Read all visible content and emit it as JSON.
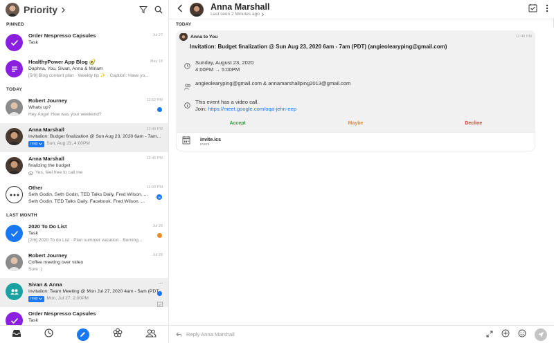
{
  "left": {
    "title": "Priority",
    "sections": {
      "pinned": "PINNED",
      "today": "TODAY",
      "last_month": "LAST MONTH"
    },
    "items": [
      {
        "name": "Order Nespresso Capsules",
        "line2": "Task",
        "line3": "",
        "time": "Jul 27"
      },
      {
        "name": "HealthyPower App Blog 🥑",
        "line2": "Daphna, You, Sivan, Anna & Miriam",
        "line3": "[5/9] Blog content plan · Weekly tip ✨ · Caption: Have yo...",
        "time": "May 18"
      },
      {
        "name": "Robert Journey",
        "line2": "Whats up?",
        "line3": "Hey Ange! How was your weekend?",
        "time": "12:52 PM"
      },
      {
        "name": "Anna Marshall",
        "line2": "Invitation: Budget finalization @ Sun Aug 23, 2020 6am - 7am...",
        "line3": "Sun, Aug 23, 4:00PM",
        "rsvp": "rsvp",
        "time": "12:48 PM"
      },
      {
        "name": "Anna Marshall",
        "line2": "finalizing the budget",
        "line3": "Yes, feel free to call me",
        "time": "12:46 PM"
      },
      {
        "name": "Other",
        "line2": "Seth Godin, Seth Godin, TED Talks Daily, Fred Wilson, ...",
        "line3": "Seth Godin. TED Talks Daily. Facebook. Fred Wilson. ...",
        "time": "12:00 PM",
        "badge": "26"
      },
      {
        "name": "2020 To Do List",
        "line2": "Task",
        "line3": "[2/6] 2020 To do List · Plan summer vacation · Burning...",
        "time": "Jul 28"
      },
      {
        "name": "Robert Journey",
        "line2": "Coffee meeting over video",
        "line3": "Sure :)",
        "time": "Jul 28"
      },
      {
        "name": "Sivan & Anna",
        "line2": "Invitation: Team Meeting @ Mon Jul 27, 2020 4am - 5am (PDT...",
        "line3": "Mon, Jul 27, 2:00PM",
        "rsvp": "rsvp",
        "time": "..."
      },
      {
        "name": "Order Nespresso Capsules",
        "line2": "Task",
        "line3": "",
        "time": ""
      }
    ]
  },
  "conversation": {
    "name": "Anna Marshall",
    "last_seen": "Last seen 2 Minutes ago",
    "day": "TODAY",
    "sender": "Anna to You",
    "time": "12:48 PM",
    "title": "Invitation: Budget finalization @ Sun Aug 23, 2020 6am - 7am (PDT) (angieolearyping@gmail.com)",
    "date_line1": "Sunday, August 23, 2020",
    "date_line2": "4:00PM → 5:00PM",
    "attendees": "angieolearyping@gmail.com & annamarshallping2013@gmail.com",
    "video_line1": "This event has a video call.",
    "video_join": "Join: ",
    "video_link": "https://meet.google.com/oqa-jehn-eep",
    "actions": {
      "accept": "Accept",
      "maybe": "Maybe",
      "decline": "Decline"
    },
    "attachment": {
      "name": "invite.ics",
      "type": "event"
    }
  },
  "reply": {
    "placeholder": "Reply Anna Marshall"
  },
  "colors": {
    "accent": "#1877f2",
    "accept": "#2e9e3e",
    "maybe": "#f08a24",
    "decline": "#e53935",
    "task_purple": "#8a1fe0",
    "teal": "#1aa1a1",
    "orange_dot": "#f08a24"
  }
}
